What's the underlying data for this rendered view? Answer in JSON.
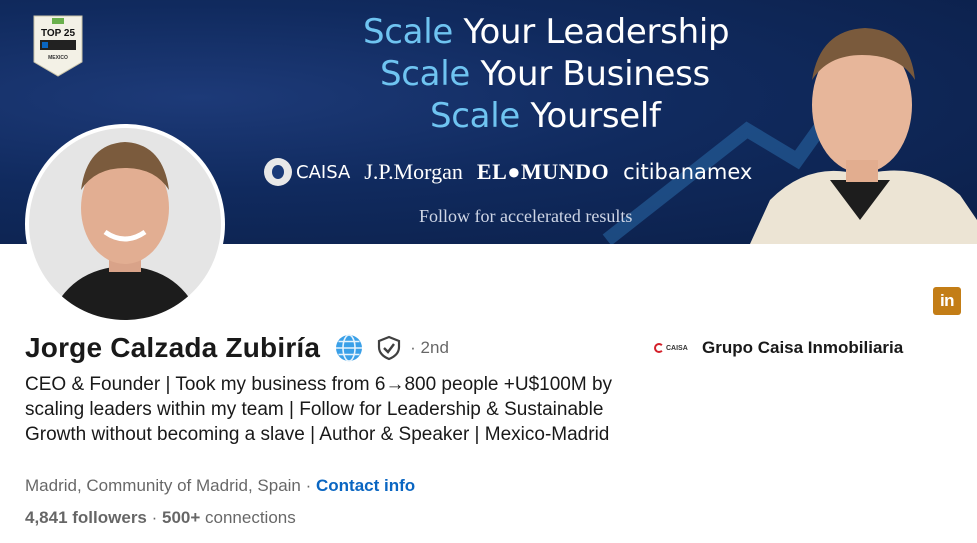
{
  "banner": {
    "badge": {
      "line1": "TOP 25",
      "line2": "MEXICO"
    },
    "headline": {
      "line1_accent": "Scale",
      "line1_rest": " Your Leadership",
      "line2_accent": "Scale",
      "line2_rest": " Your Business",
      "line3_accent": "Scale",
      "line3_rest": " Yourself"
    },
    "logos": {
      "caisa": "CAISA",
      "jpmorgan": "J.P.Morgan",
      "elmundo": "EL●MUNDO",
      "citibanamex": "citibanamex"
    },
    "follow_text": "Follow for accelerated results"
  },
  "profile": {
    "name": "Jorge Calzada Zubiría",
    "degree": "· 2nd",
    "headline": "CEO & Founder | Took my business from 6→800 people +U$100M by scaling leaders within my team | Follow for Leadership & Sustainable Growth without becoming a slave |  Author & Speaker | Mexico-Madrid",
    "location": "Madrid, Community of Madrid, Spain",
    "location_sep": " · ",
    "contact_info": "Contact info",
    "followers": "4,841 followers",
    "stats_sep": " · ",
    "connections": "500+",
    "connections_label": " connections"
  },
  "company": {
    "logo_text": "CAISA",
    "name": "Grupo Caisa Inmobiliaria"
  },
  "linkedin_badge": "in",
  "colors": {
    "banner_bg": "#0b1f48",
    "accent_blue": "#6fc4f1",
    "link_blue": "#0a66c2",
    "linkedin_gold": "#c37d16"
  },
  "icons": [
    "globe-icon",
    "verified-shield-icon",
    "linkedin-icon"
  ]
}
